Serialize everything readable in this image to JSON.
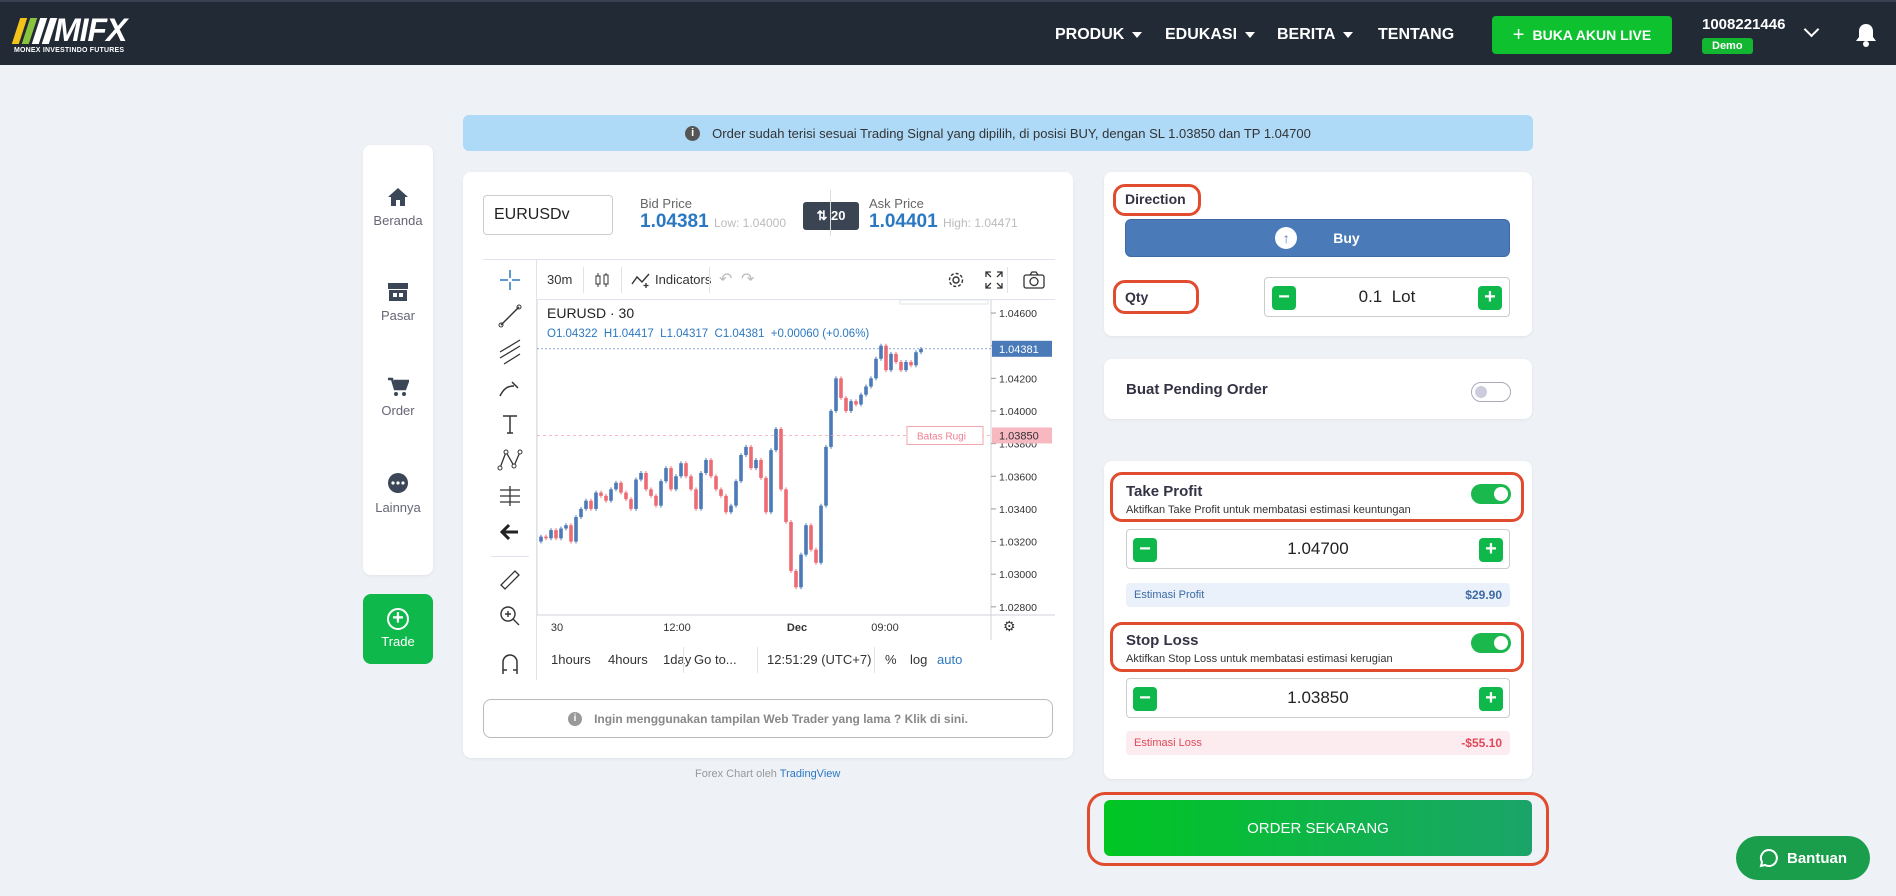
{
  "brand": {
    "logo_text": "MIFX",
    "logo_sub": "MONEX INVESTINDO FUTURES"
  },
  "nav": {
    "items": [
      "PRODUK",
      "EDUKASI",
      "BERITA",
      "TENTANG"
    ],
    "live_button": "BUKA AKUN LIVE",
    "account_number": "1008221446",
    "account_type": "Demo"
  },
  "sidebar": {
    "items": [
      "Beranda",
      "Pasar",
      "Order",
      "Lainnya"
    ],
    "trade": "Trade"
  },
  "banner": "Order sudah terisi sesuai Trading Signal yang dipilih, di posisi BUY, dengan SL 1.03850 dan TP 1.04700",
  "quote": {
    "symbol": "EURUSDv",
    "bid_label": "Bid Price",
    "bid": "1.04381",
    "low": "Low: 1.04000",
    "spread": "20",
    "ask_label": "Ask Price",
    "ask": "1.04401",
    "high": "High: 1.04471"
  },
  "chart_toolbar": {
    "interval": "30m",
    "indicators": "Indicators"
  },
  "chart_data": {
    "type": "candlestick",
    "title": "EURUSD · 30",
    "ohlc_text": "O1.04322  H1.04417  L1.04317  C1.04381  +0.00060 (+0.06%)",
    "y_ticks": [
      "1.04600",
      "1.04400",
      "1.04200",
      "1.04000",
      "1.03800",
      "1.03600",
      "1.03400",
      "1.03200",
      "1.03000",
      "1.02800"
    ],
    "x_ticks": [
      "30",
      "12:00",
      "Dec",
      "09:00"
    ],
    "last_price": "1.04381",
    "stop_label": "Batas Rugi",
    "stop_price": "1.03850",
    "ylim": [
      1.0275,
      1.0468
    ],
    "closes": [
      1.0323,
      1.0322,
      1.0327,
      1.0322,
      1.0328,
      1.033,
      1.032,
      1.0335,
      1.034,
      1.0345,
      1.034,
      1.035,
      1.0348,
      1.0345,
      1.0352,
      1.0356,
      1.035,
      1.0346,
      1.034,
      1.0358,
      1.0362,
      1.0352,
      1.0348,
      1.0342,
      1.0357,
      1.0365,
      1.0352,
      1.036,
      1.0368,
      1.036,
      1.0352,
      1.034,
      1.0362,
      1.037,
      1.036,
      1.0352,
      1.0348,
      1.0338,
      1.0342,
      1.0357,
      1.0373,
      1.0378,
      1.0365,
      1.037,
      1.0359,
      1.0338,
      1.0376,
      1.0389,
      1.0352,
      1.0332,
      1.0302,
      1.0292,
      1.0312,
      1.033,
      1.0315,
      1.0307,
      1.0342,
      1.0378,
      1.04,
      1.042,
      1.0408,
      1.04,
      1.0406,
      1.0404,
      1.041,
      1.0415,
      1.042,
      1.0432,
      1.044,
      1.0425,
      1.0435,
      1.043,
      1.0425,
      1.043,
      1.0428,
      1.0436,
      1.0438
    ]
  },
  "chart_bottom": {
    "ranges": [
      "1hours",
      "4hours",
      "1day"
    ],
    "goto": "Go to...",
    "clock": "12:51:29 (UTC+7)",
    "pct": "%",
    "log": "log",
    "auto": "auto"
  },
  "old_trader_note": "Ingin menggunakan tampilan Web Trader yang lama ? Klik di sini.",
  "chart_credit": {
    "text": "Forex Chart oleh",
    "link": "TradingView"
  },
  "order_form": {
    "direction_label": "Direction",
    "direction": "Buy",
    "qty_label": "Qty",
    "qty_value": "0.1",
    "qty_unit": "Lot",
    "pending_label": "Buat Pending Order",
    "pending_enabled": false,
    "tp_label": "Take Profit",
    "tp_sub": "Aktifkan Take Profit untuk membatasi estimasi keuntungan",
    "tp_enabled": true,
    "tp_value": "1.04700",
    "est_profit_label": "Estimasi Profit",
    "est_profit": "$29.90",
    "sl_label": "Stop Loss",
    "sl_sub": "Aktifkan Stop Loss untuk membatasi estimasi kerugian",
    "sl_enabled": true,
    "sl_value": "1.03850",
    "est_loss_label": "Estimasi Loss",
    "est_loss": "-$55.10",
    "submit": "ORDER SEKARANG"
  },
  "help_button": "Bantuan",
  "colors": {
    "nav_bg": "#222a36",
    "green": "#0eb84b",
    "blue": "#2b78c2",
    "up": "#4a7ab8",
    "down": "#ef6b73",
    "highlight": "#e14b2e"
  }
}
